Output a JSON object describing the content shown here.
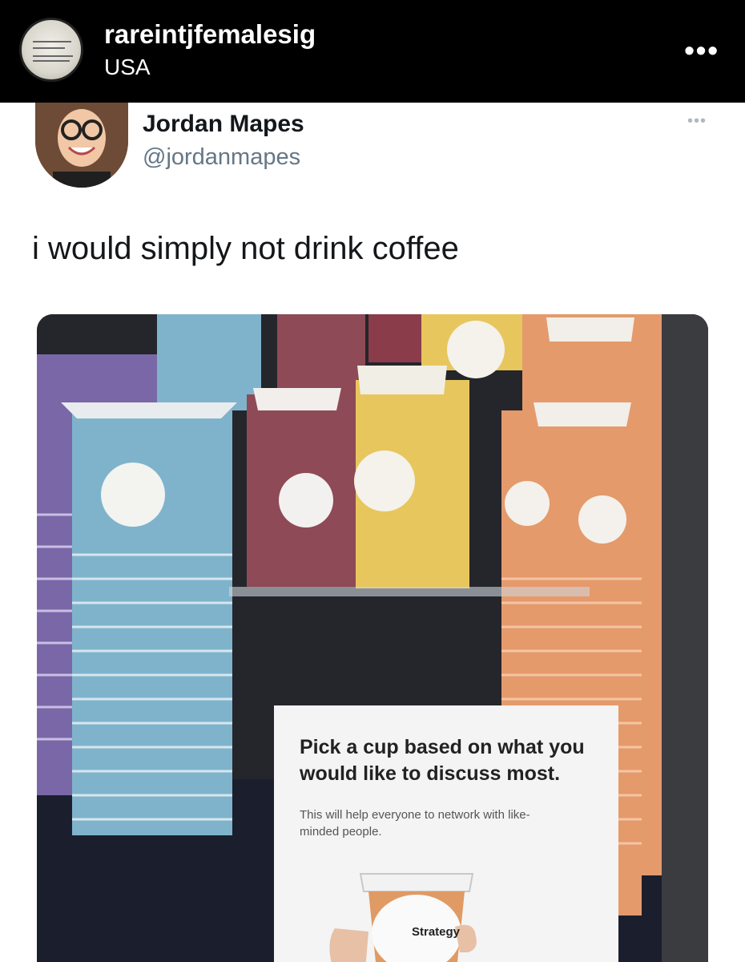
{
  "header": {
    "username": "rareintjfemalesig",
    "location": "USA",
    "more_icon": "more-horizontal-icon"
  },
  "tweet": {
    "name": "Jordan Mapes",
    "handle": "@jordanmapes",
    "text": "i would simply not drink coffee",
    "more_icon": "more-horizontal-icon"
  },
  "photo": {
    "sign_headline": "Pick a cup based on what you would like to discuss most.",
    "sign_subtext": "This will help everyone to network with like-minded people.",
    "cup_label": "Strategy"
  },
  "colors": {
    "cup_blue": "#7fb3cc",
    "cup_maroon": "#8e4a56",
    "cup_yellow": "#e7c65d",
    "cup_orange": "#e59a6b",
    "cup_purple": "#7d6aa9"
  }
}
